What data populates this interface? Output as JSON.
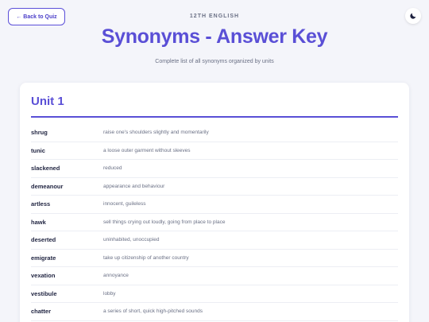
{
  "nav": {
    "back_label": "← Back to Quiz",
    "theme_icon": "moon-icon"
  },
  "header": {
    "subject": "12TH ENGLISH",
    "title": "Synonyms - Answer Key",
    "description": "Complete list of all synonyms organized by units"
  },
  "unit": {
    "title": "Unit 1",
    "rows": [
      {
        "word": "shrug",
        "meaning": "raise one's shoulders slightly and momentarily"
      },
      {
        "word": "tunic",
        "meaning": "a loose outer garment without sleeves"
      },
      {
        "word": "slackened",
        "meaning": "reduced"
      },
      {
        "word": "demeanour",
        "meaning": "appearance and behaviour"
      },
      {
        "word": "artless",
        "meaning": "innocent, guileless"
      },
      {
        "word": "hawk",
        "meaning": "sell things crying out loudly, going from place to place"
      },
      {
        "word": "deserted",
        "meaning": "uninhabited, unoccupied"
      },
      {
        "word": "emigrate",
        "meaning": "take up citizenship of another country"
      },
      {
        "word": "vexation",
        "meaning": "annoyance"
      },
      {
        "word": "vestibule",
        "meaning": "lobby"
      },
      {
        "word": "chatter",
        "meaning": "a series of short, quick high-pitched sounds"
      }
    ]
  },
  "colors": {
    "accent": "#5a4fd6",
    "background": "#f4f5fa"
  }
}
